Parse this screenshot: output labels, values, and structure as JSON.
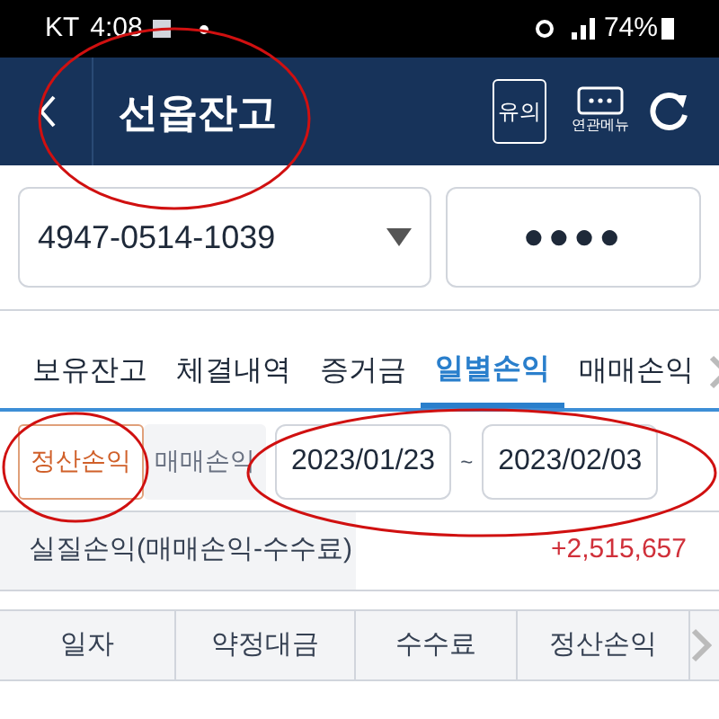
{
  "status_bar": {
    "carrier": "KT",
    "time": "4:08",
    "battery": "74%"
  },
  "header": {
    "title": "선옵잔고",
    "notice_button": "유의",
    "menu_label": "연관메뉴"
  },
  "account": {
    "number": "4947-0514-1039",
    "password": "●●●●"
  },
  "tabs": [
    {
      "label": "보유잔고",
      "selected": false
    },
    {
      "label": "체결내역",
      "selected": false
    },
    {
      "label": "증거금",
      "selected": false
    },
    {
      "label": "일별손익",
      "selected": true
    },
    {
      "label": "매매손익",
      "selected": false
    }
  ],
  "filter": {
    "toggles": [
      {
        "label": "정산손익",
        "selected": true
      },
      {
        "label": "매매손익",
        "selected": false
      }
    ],
    "start_date": "2023/01/23",
    "separator": "~",
    "end_date": "2023/02/03"
  },
  "summary": {
    "label": "실질손익(매매손익-수수료)",
    "value": "+2,515,657"
  },
  "table": {
    "columns": [
      "일자",
      "약정대금",
      "수수료",
      "정산손익"
    ]
  }
}
